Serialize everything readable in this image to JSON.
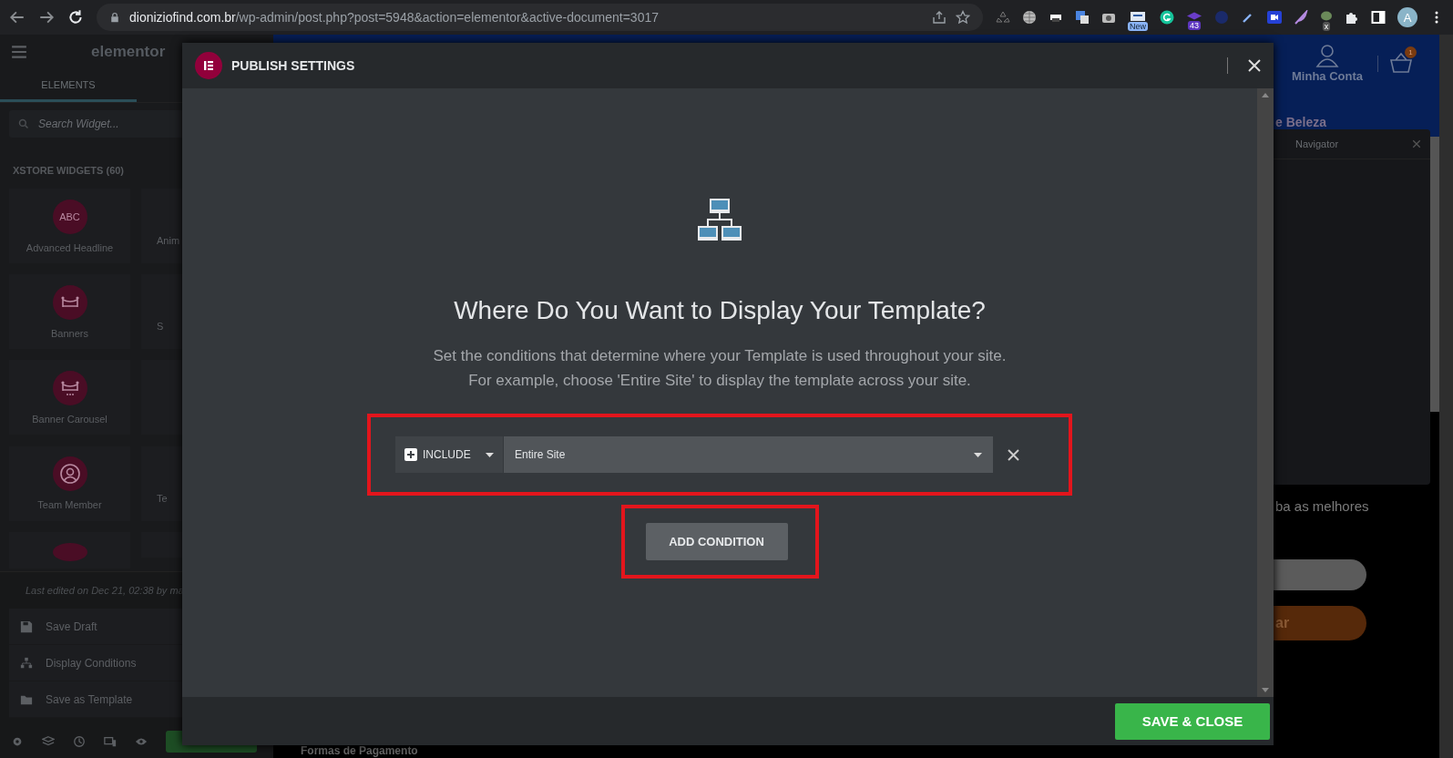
{
  "browser": {
    "url": "**dioniziofind.com.br**/wp-admin/post.php?post=5948&action=elementor&active-document=3017",
    "badges": [
      "New",
      "43",
      "x"
    ],
    "avatar": "A"
  },
  "editor_panel": {
    "logo": "elementor",
    "tabs": [
      {
        "label": "ELEMENTS",
        "selected": true
      }
    ],
    "search": {
      "placeholder": "Search Widget..."
    },
    "category": "XSTORE WIDGETS (60)",
    "widget_rows": [
      {
        "name": "Advanced Headline",
        "kind": "abc",
        "icon_text": "ABC",
        "neighbor": "Anim"
      },
      {
        "name": "Banners",
        "kind": "banner",
        "neighbor": "S"
      },
      {
        "name": "Banner Carousel",
        "kind": "carousel"
      },
      {
        "name": "Team Member",
        "kind": "person",
        "neighbor": "Te"
      }
    ],
    "last_edited": "Last edited on Dec 21, 02:38 by ma",
    "menu": [
      {
        "label": "Save Draft",
        "kind": "save"
      },
      {
        "label": "Display Conditions",
        "kind": "sitemap"
      },
      {
        "label": "Save as Template",
        "kind": "folder"
      }
    ]
  },
  "preview": {
    "account": "Minha Conta",
    "cart_count": "1",
    "heading": "e Beleza",
    "text": "ba as melhores",
    "button": "ar",
    "footer_heading": "Formas de Pagamento"
  },
  "navigator": {
    "title": "Navigator"
  },
  "modal": {
    "title": "PUBLISH SETTINGS",
    "heading": "Where Do You Want to Display Your Template?",
    "description": [
      "Set the conditions that determine where your Template is used throughout your site.",
      "For example, choose 'Entire Site' to display the template across your site."
    ],
    "conditions_highlighted": true,
    "conditions": [
      {
        "type": "INCLUDE",
        "value": "Entire Site"
      }
    ],
    "add_button": {
      "label": "ADD CONDITION",
      "highlighted": true
    },
    "save_button": "SAVE & CLOSE"
  }
}
